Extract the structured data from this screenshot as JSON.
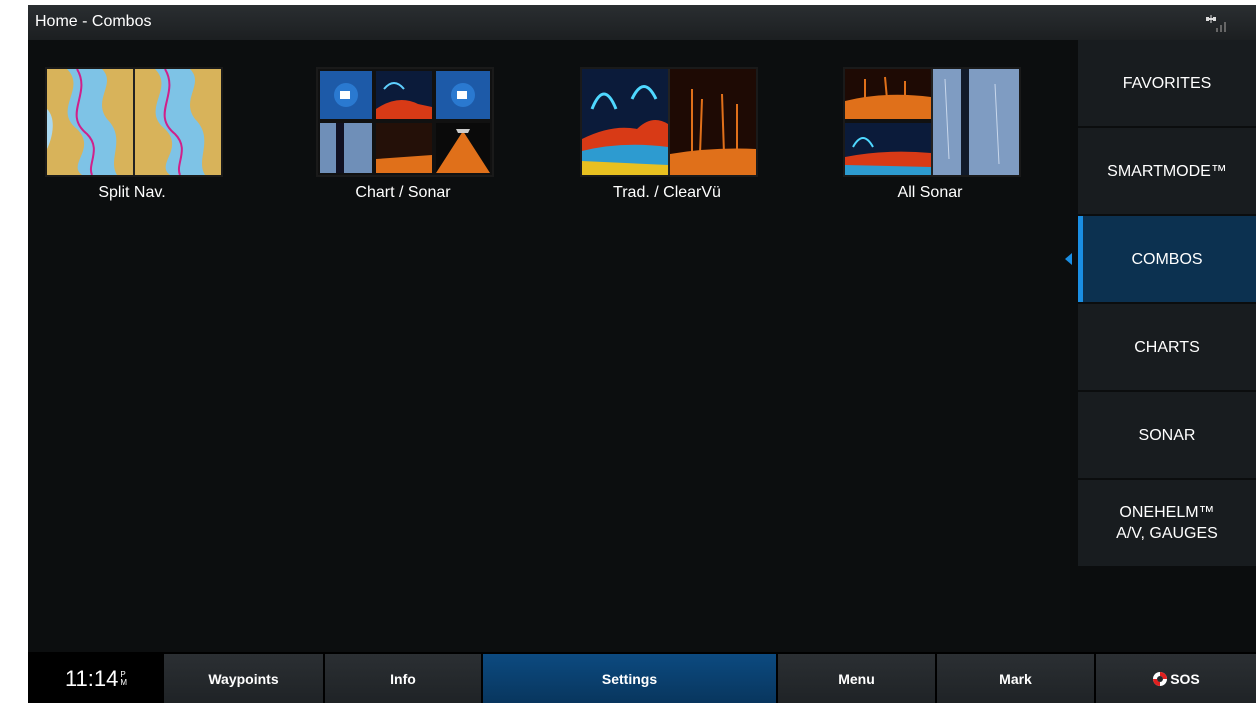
{
  "header": {
    "title": "Home - Combos",
    "gps_icon": "gps-signal-icon"
  },
  "tiles": [
    {
      "label": "Split Nav."
    },
    {
      "label": "Chart / Sonar"
    },
    {
      "label": "Trad. / ClearVü"
    },
    {
      "label": "All Sonar"
    }
  ],
  "sidebar": {
    "items": [
      {
        "label": "FAVORITES"
      },
      {
        "label": "SMARTMODE™"
      },
      {
        "label": "COMBOS"
      },
      {
        "label": "CHARTS"
      },
      {
        "label": "SONAR"
      },
      {
        "label": "ONEHELM™\nA/V, GAUGES"
      }
    ],
    "active_index": 2
  },
  "footer": {
    "time": "11:14",
    "ampm": "P M",
    "buttons": [
      {
        "label": "Waypoints"
      },
      {
        "label": "Info"
      },
      {
        "label": "Settings"
      },
      {
        "label": "Menu"
      },
      {
        "label": "Mark"
      },
      {
        "label": "SOS",
        "icon": "lifebuoy-icon"
      }
    ],
    "selected": "Settings"
  },
  "colors": {
    "accent": "#1a8ee3",
    "active_tab": "#0c3150",
    "selected_button": "#0c4a80",
    "sos_red": "#e02020"
  }
}
